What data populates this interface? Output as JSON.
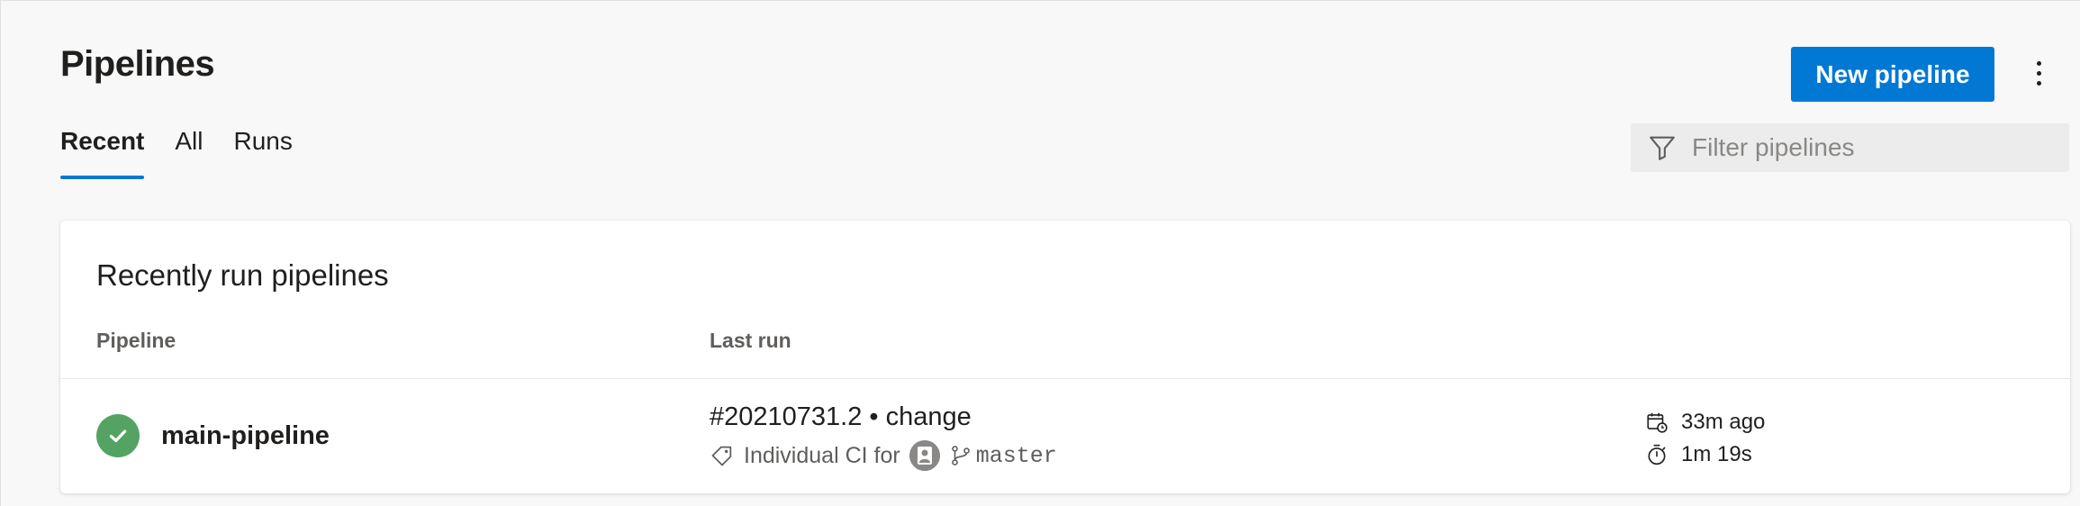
{
  "header": {
    "title": "Pipelines",
    "new_pipeline_label": "New pipeline"
  },
  "tabs": [
    {
      "label": "Recent",
      "selected": true
    },
    {
      "label": "All",
      "selected": false
    },
    {
      "label": "Runs",
      "selected": false
    }
  ],
  "filter": {
    "placeholder": "Filter pipelines",
    "value": ""
  },
  "card": {
    "title": "Recently run pipelines",
    "columns": {
      "pipeline": "Pipeline",
      "last_run": "Last run"
    },
    "rows": [
      {
        "status": "succeeded",
        "status_icon": "check-circle-icon",
        "pipeline_name": "main-pipeline",
        "run_title": "#20210731.2 • change",
        "trigger_text": "Individual CI for",
        "branch": "master",
        "time_ago": "33m ago",
        "duration": "1m 19s"
      }
    ]
  },
  "colors": {
    "accent": "#0078d4",
    "success": "#55a362",
    "background": "#f8f8f8"
  }
}
